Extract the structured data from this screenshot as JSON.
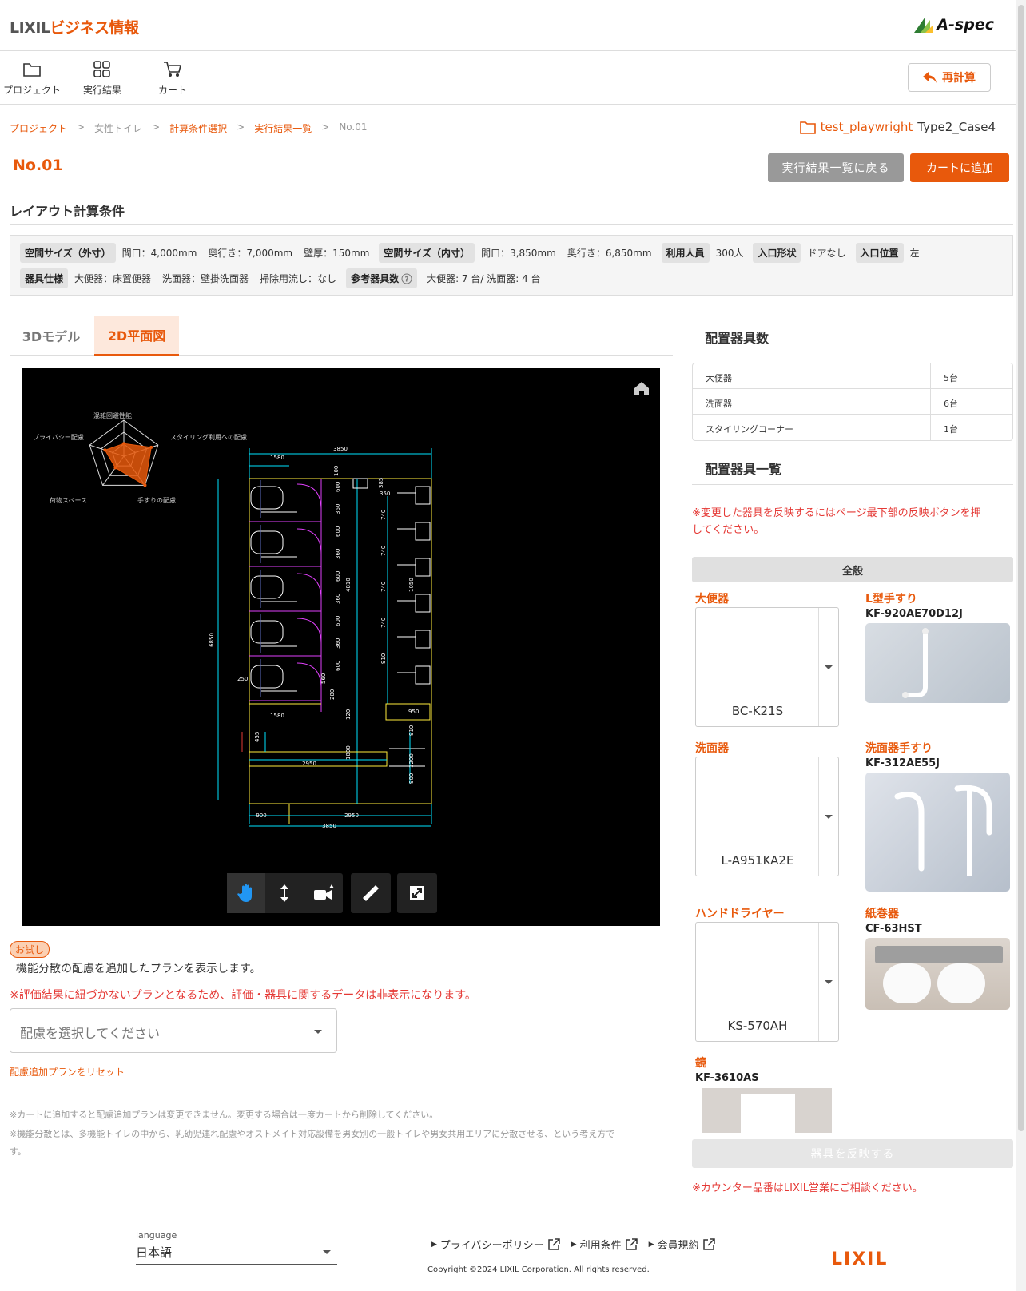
{
  "header": {
    "brand_prefix": "LIXIL",
    "brand_suffix": "ビジネス情報",
    "aspec_label": "A-spec"
  },
  "toolbar": {
    "project_label": "プロジェクト",
    "results_label": "実行結果",
    "cart_label": "カート",
    "recalc_label": "再計算"
  },
  "breadcrumb": {
    "items": [
      "プロジェクト",
      "女性トイレ",
      "計算条件選択",
      "実行結果一覧",
      "No.01"
    ],
    "sep": ">"
  },
  "project": {
    "name": "test_playwright",
    "case": "Type2_Case4"
  },
  "page": {
    "title": "No.01",
    "back_label": "実行結果一覧に戻る",
    "add_cart_label": "カートに追加"
  },
  "conditions": {
    "heading": "レイアウト計算条件",
    "outer_tag": "空間サイズ（外寸）",
    "outer_width": "間口：4,000mm",
    "outer_depth": "奥行き：7,000mm",
    "wall": "壁厚：150mm",
    "inner_tag": "空間サイズ（内寸）",
    "inner_width": "間口：3,850mm",
    "inner_depth": "奥行き：6,850mm",
    "users_tag": "利用人員",
    "users": "300人",
    "entry_tag": "入口形状",
    "entry": "ドアなし",
    "entry_pos_tag": "入口位置",
    "entry_pos": "左",
    "spec_tag": "器具仕様",
    "spec_toilet": "大便器：床置便器",
    "spec_sink": "洗面器：壁掛洗面器",
    "spec_mop": "掃除用流し：なし",
    "ref_tag": "参考器具数",
    "ref_value": "大便器: 7 台/ 洗面器: 4 台"
  },
  "tabs": {
    "tab_3d": "3Dモデル",
    "tab_2d": "2D平面図"
  },
  "radar": {
    "labels": [
      "混雑回避性能",
      "スタイリング利用への配慮",
      "手すりの配慮",
      "荷物スペース",
      "プライバシー配慮"
    ],
    "values": [
      0.35,
      0.8,
      1.0,
      0.4,
      0.55
    ],
    "colors": {
      "fill": "#e8590c",
      "grid": "#dddddd"
    }
  },
  "plan": {
    "dims": {
      "top_total": "3850",
      "top_left": "1580",
      "left_total": "6850",
      "stall_depth": "1580",
      "bottom_total": "3850",
      "bottom_left": "900",
      "bottom_right": "2950",
      "mid": "2950",
      "d4810": "4810",
      "d250": "250",
      "d455": "455",
      "d1800": "1800",
      "d1050": "1050",
      "d900": "900",
      "d1200": "1200",
      "d100": "100",
      "d385": "385",
      "d350": "350",
      "d950": "950",
      "d560": "560",
      "d280": "280",
      "d120": "120",
      "d910": "910"
    },
    "stall_dims": [
      "600",
      "360",
      "600",
      "360",
      "600",
      "360",
      "600",
      "360",
      "600"
    ],
    "right_dims": [
      "740",
      "740",
      "740",
      "740",
      "910"
    ]
  },
  "trial": {
    "badge": "お試し",
    "desc": "機能分散の配慮を追加したプランを表示します。",
    "warning": "※評価結果に紐づかないプランとなるため、評価・器具に関するデータは非表示になります。",
    "select_placeholder": "配慮を選択してください",
    "reset_label": "配慮追加プランをリセット"
  },
  "notes": {
    "n1": "※カートに追加すると配慮追加プランは変更できません。変更する場合は一度カートから削除してください。",
    "n2a": "※機能分散とは、多機能トイレの中から、乳幼児連れ配慮やオストメイト対応設備を男女別の一般トイレや男女共用エリアに分散させる、という考え方で",
    "n2b": "す。"
  },
  "counts": {
    "heading": "配置器具数",
    "rows": [
      {
        "name": "大便器",
        "count": "5台"
      },
      {
        "name": "洗面器",
        "count": "6台"
      },
      {
        "name": "スタイリングコーナー",
        "count": "1台"
      }
    ]
  },
  "fixtures": {
    "heading": "配置器具一覧",
    "notice1": "※変更した器具を反映するにはページ最下部の反映ボタンを押",
    "notice2": "してください。",
    "section": "全般",
    "toilet": {
      "cat": "大便器",
      "value": "BC-K21S"
    },
    "lrail": {
      "cat": "L型手すり",
      "code": "KF-920AE70D12J"
    },
    "sink": {
      "cat": "洗面器",
      "value": "L-A951KA2E"
    },
    "sinkrail": {
      "cat": "洗面器手すり",
      "code": "KF-312AE55J"
    },
    "dryer": {
      "cat": "ハンドドライヤー",
      "value": "KS-570AH"
    },
    "paper": {
      "cat": "紙巻器",
      "code": "CF-63HST"
    },
    "mirror": {
      "cat": "鏡",
      "code": "KF-3610AS"
    },
    "reflect_label": "器具を反映する",
    "counter_note": "※カウンター品番はLIXIL営業にご相談ください。"
  },
  "footer": {
    "lang_label": "language",
    "lang_value": "日本語",
    "privacy": "プライバシーポリシー",
    "terms": "利用条件",
    "member": "会員規約",
    "copyright": "Copyright ©2024 LIXIL Corporation. All rights reserved.",
    "logo": "LIXIL"
  }
}
